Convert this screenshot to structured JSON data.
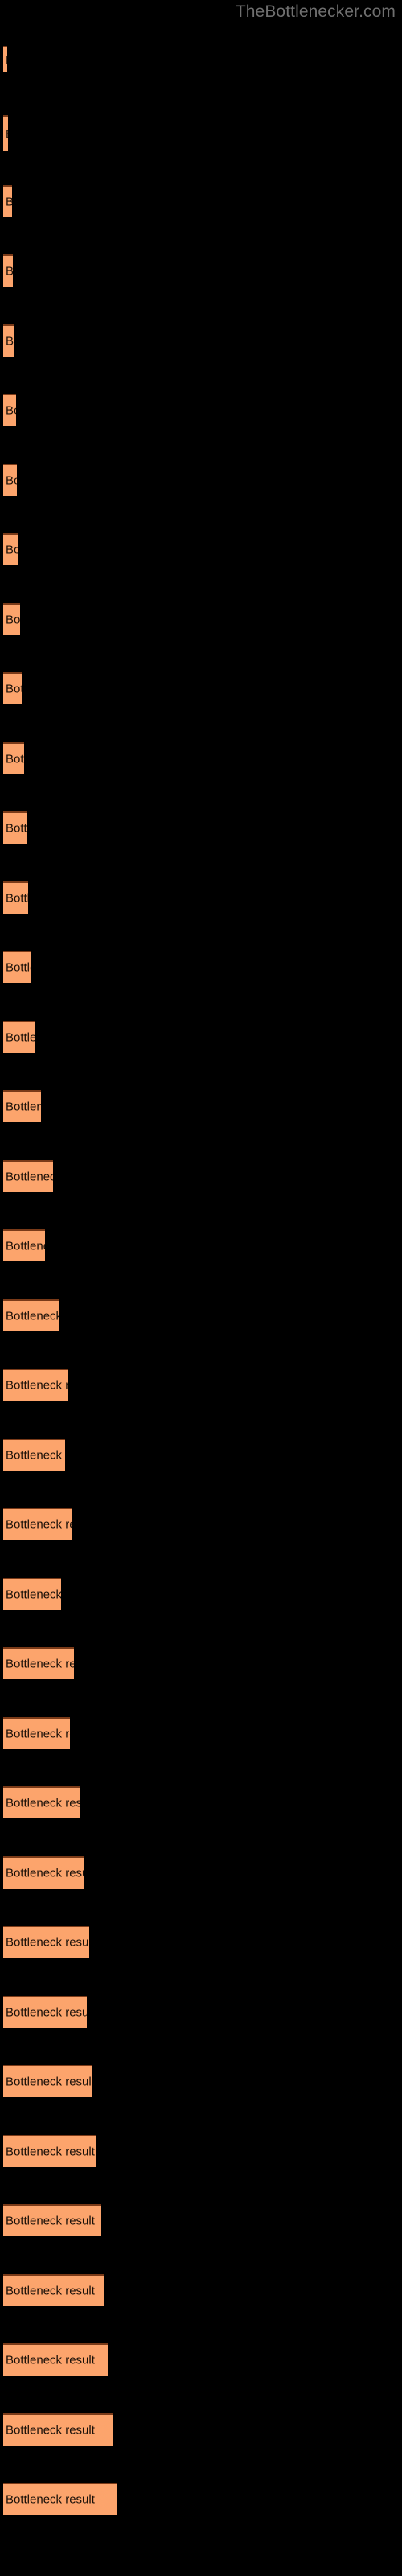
{
  "site": {
    "title": "TheBottlenecker.com"
  },
  "colors": {
    "background": "#000000",
    "bar_fill": "#fca46c",
    "bar_top_border": "#7a3a18",
    "label_text": "#1a1008",
    "title_text": "#6f6f6f"
  },
  "chart_data": {
    "type": "bar",
    "orientation": "horizontal",
    "title": "TheBottlenecker.com",
    "xlabel": "",
    "ylabel": "",
    "grid": false,
    "legend": null,
    "xlim": [
      0,
      500
    ],
    "bar_label_text": "Bottleneck result",
    "categories": [
      "Bottleneck result",
      "Bottleneck result",
      "Bottleneck result",
      "Bottleneck result",
      "Bottleneck result",
      "Bottleneck result",
      "Bottleneck result",
      "Bottleneck result",
      "Bottleneck result",
      "Bottleneck result",
      "Bottleneck result",
      "Bottleneck result",
      "Bottleneck result",
      "Bottleneck result",
      "Bottleneck result",
      "Bottleneck result",
      "Bottleneck result",
      "Bottleneck result",
      "Bottleneck result",
      "Bottleneck result",
      "Bottleneck result",
      "Bottleneck result",
      "Bottleneck result",
      "Bottleneck result",
      "Bottleneck result",
      "Bottleneck result",
      "Bottleneck result",
      "Bottleneck result",
      "Bottleneck result",
      "Bottleneck result",
      "Bottleneck result",
      "Bottleneck result",
      "Bottleneck result",
      "Bottleneck result",
      "Bottleneck result",
      "Bottleneck result"
    ],
    "values": [
      5,
      6,
      11,
      12,
      13,
      16,
      17,
      18,
      21,
      23,
      26,
      29,
      31,
      34,
      39,
      47,
      62,
      52,
      70,
      81,
      77,
      86,
      72,
      88,
      83,
      95,
      100,
      107,
      104,
      111,
      116,
      121,
      125,
      130,
      136,
      141
    ]
  },
  "bars": [
    {
      "label": "Bottleneck result",
      "y": 57,
      "width": 5,
      "height": 33
    },
    {
      "label": "Bottleneck result",
      "y": 143,
      "width": 6,
      "height": 45
    },
    {
      "label": "Bottleneck result",
      "y": 230,
      "width": 11,
      "height": 40
    },
    {
      "label": "Bottleneck result",
      "y": 316,
      "width": 12,
      "height": 40
    },
    {
      "label": "Bottleneck result",
      "y": 403,
      "width": 13,
      "height": 40
    },
    {
      "label": "Bottleneck result",
      "y": 489,
      "width": 16,
      "height": 40
    },
    {
      "label": "Bottleneck result",
      "y": 576,
      "width": 17,
      "height": 40
    },
    {
      "label": "Bottleneck result",
      "y": 662,
      "width": 18,
      "height": 40
    },
    {
      "label": "Bottleneck result",
      "y": 749,
      "width": 21,
      "height": 40
    },
    {
      "label": "Bottleneck result",
      "y": 835,
      "width": 23,
      "height": 40
    },
    {
      "label": "Bottleneck result",
      "y": 922,
      "width": 26,
      "height": 40
    },
    {
      "label": "Bottleneck result",
      "y": 1008,
      "width": 29,
      "height": 40
    },
    {
      "label": "Bottleneck result",
      "y": 1095,
      "width": 31,
      "height": 40
    },
    {
      "label": "Bottleneck result",
      "y": 1181,
      "width": 34,
      "height": 40
    },
    {
      "label": "Bottleneck result",
      "y": 1268,
      "width": 39,
      "height": 40
    },
    {
      "label": "Bottleneck result",
      "y": 1354,
      "width": 47,
      "height": 40
    },
    {
      "label": "Bottleneck result",
      "y": 1441,
      "width": 62,
      "height": 40
    },
    {
      "label": "Bottleneck result",
      "y": 1527,
      "width": 52,
      "height": 40
    },
    {
      "label": "Bottleneck result",
      "y": 1614,
      "width": 70,
      "height": 40
    },
    {
      "label": "Bottleneck result",
      "y": 1700,
      "width": 81,
      "height": 40
    },
    {
      "label": "Bottleneck result",
      "y": 1787,
      "width": 77,
      "height": 40
    },
    {
      "label": "Bottleneck result",
      "y": 1873,
      "width": 86,
      "height": 40
    },
    {
      "label": "Bottleneck result",
      "y": 1960,
      "width": 72,
      "height": 40
    },
    {
      "label": "Bottleneck result",
      "y": 2046,
      "width": 88,
      "height": 40
    },
    {
      "label": "Bottleneck result",
      "y": 2133,
      "width": 83,
      "height": 40
    },
    {
      "label": "Bottleneck result",
      "y": 2219,
      "width": 95,
      "height": 40
    },
    {
      "label": "Bottleneck result",
      "y": 2306,
      "width": 100,
      "height": 40
    },
    {
      "label": "Bottleneck result",
      "y": 2392,
      "width": 107,
      "height": 40
    },
    {
      "label": "Bottleneck result",
      "y": 2479,
      "width": 104,
      "height": 40
    },
    {
      "label": "Bottleneck result",
      "y": 2565,
      "width": 111,
      "height": 40
    },
    {
      "label": "Bottleneck result",
      "y": 2652,
      "width": 116,
      "height": 40
    },
    {
      "label": "Bottleneck result",
      "y": 2738,
      "width": 121,
      "height": 40
    },
    {
      "label": "Bottleneck result",
      "y": 2825,
      "width": 125,
      "height": 40
    },
    {
      "label": "Bottleneck result",
      "y": 2911,
      "width": 130,
      "height": 40
    },
    {
      "label": "Bottleneck result",
      "y": 2998,
      "width": 136,
      "height": 40
    },
    {
      "label": "Bottleneck result",
      "y": 3084,
      "width": 141,
      "height": 40
    }
  ]
}
